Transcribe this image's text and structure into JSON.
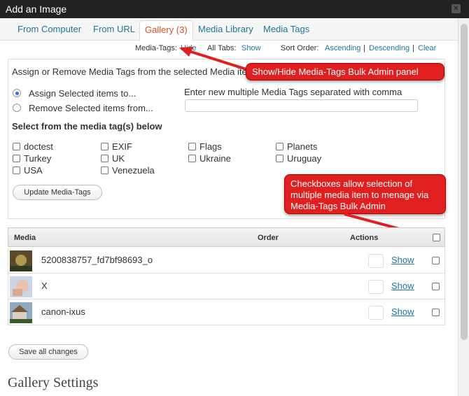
{
  "window": {
    "title": "Add an Image",
    "close_glyph": "×"
  },
  "tabs": [
    {
      "label": "From Computer"
    },
    {
      "label": "From URL"
    },
    {
      "label": "Gallery (3)"
    },
    {
      "label": "Media Library"
    },
    {
      "label": "Media Tags"
    }
  ],
  "filter": {
    "media_tags_label": "Media-Tags:",
    "media_tags_link": "Hide",
    "all_tabs_label": "All Tabs:",
    "all_tabs_link": "Show",
    "sort_label": "Sort Order:",
    "ascending": "Ascending",
    "sep1": "|",
    "descending": "Descending",
    "sep2": "|",
    "clear": "Clear"
  },
  "bulk_panel": {
    "intro": "Assign or Remove Media Tags from the selected Media ite",
    "assign_label": "Assign Selected items to...",
    "remove_label": "Remove Selected items from...",
    "new_tags_label": "Enter new multiple Media Tags separated with comma",
    "new_tags_value": "",
    "select_heading": "Select from the media tag(s) below",
    "tags": [
      {
        "label": "doctest"
      },
      {
        "label": "EXIF"
      },
      {
        "label": "Flags"
      },
      {
        "label": "Planets"
      },
      {
        "label": "Turkey"
      },
      {
        "label": "UK"
      },
      {
        "label": "Ukraine"
      },
      {
        "label": "Uruguay"
      },
      {
        "label": "USA"
      },
      {
        "label": "Venezuela"
      }
    ],
    "update_button": "Update Media-Tags"
  },
  "media_table": {
    "col_media": "Media",
    "col_order": "Order",
    "col_actions": "Actions",
    "rows": [
      {
        "name": "5200838757_fd7bf98693_o",
        "action": "Show"
      },
      {
        "name": "X",
        "action": "Show"
      },
      {
        "name": "canon-ixus",
        "action": "Show"
      }
    ]
  },
  "save_button": "Save all changes",
  "gallery_settings_title": "Gallery Settings",
  "callouts": {
    "toggle_panel": "Show/Hide Media-Tags Bulk Admin panel",
    "checkboxes": "Checkboxes allow selection of multiple media item to menage via Media-Tags Bulk Admin"
  },
  "colors": {
    "link": "#21759b",
    "active_tab": "#d54e21",
    "callout_bg": "#e02020",
    "titlebar_bg": "#222222"
  }
}
